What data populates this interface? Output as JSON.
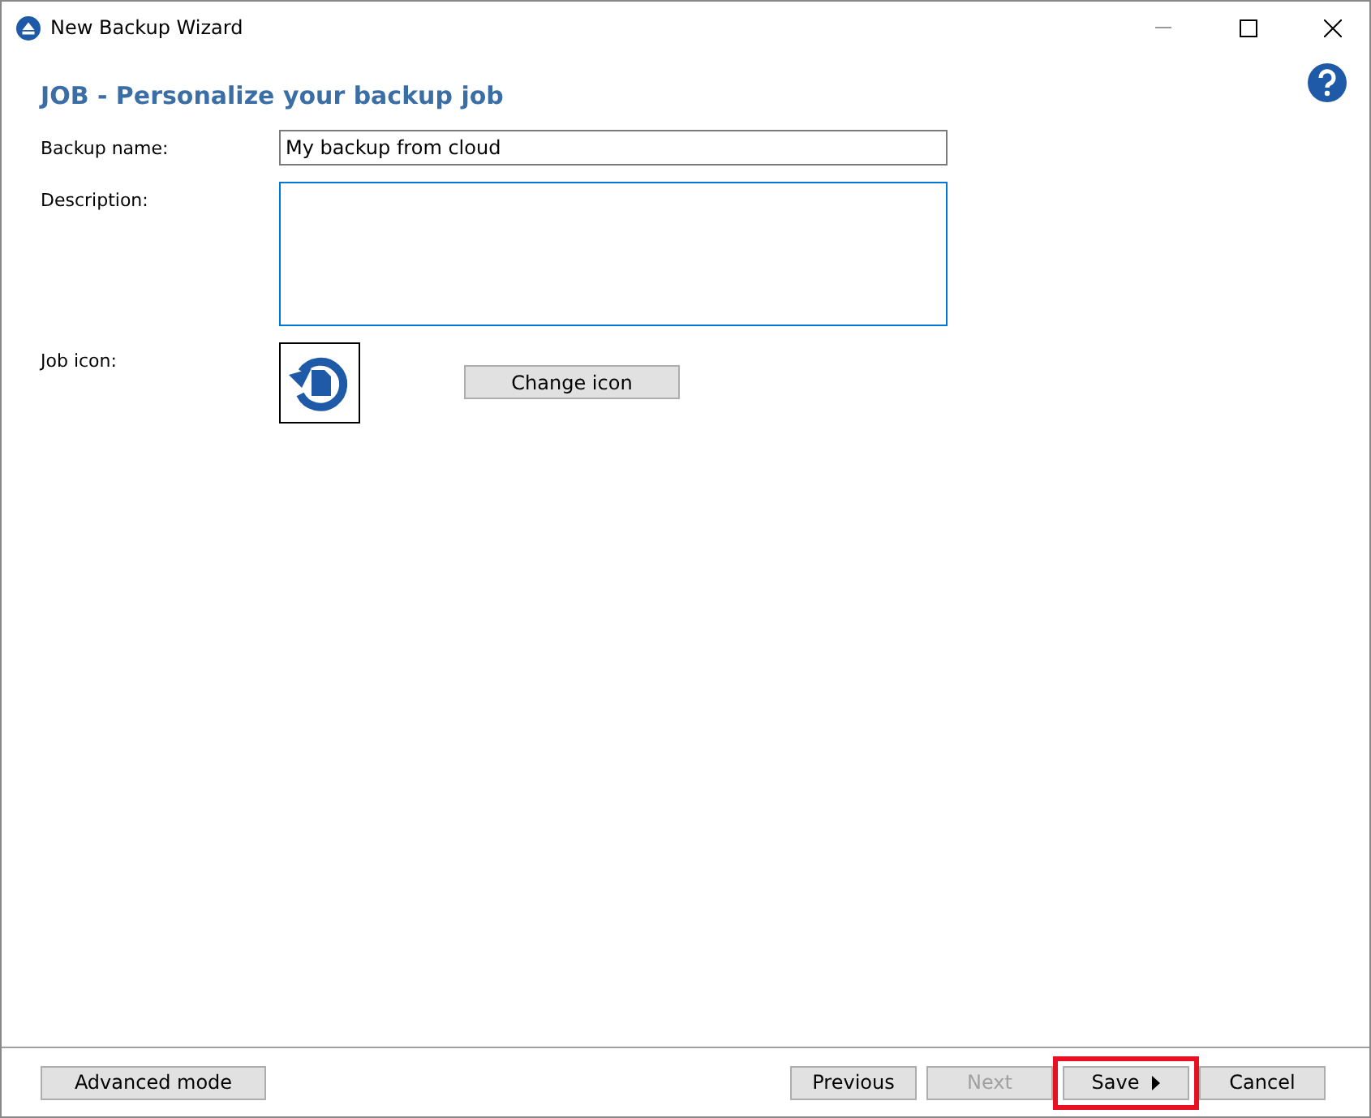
{
  "window": {
    "title": "New Backup Wizard"
  },
  "heading": "JOB - Personalize your backup job",
  "form": {
    "name_label": "Backup name:",
    "name_value": "My backup from cloud",
    "description_label": "Description:",
    "icon_label": "Job icon:",
    "change_icon": "Change icon"
  },
  "footer": {
    "advanced": "Advanced mode",
    "buttons": [
      {
        "label": "Previous",
        "disabled": false,
        "highlighted": false,
        "arrow": false
      },
      {
        "label": "Next",
        "disabled": true,
        "highlighted": false,
        "arrow": false
      },
      {
        "label": "Save",
        "disabled": false,
        "highlighted": true,
        "arrow": true
      },
      {
        "label": "Cancel",
        "disabled": false,
        "highlighted": false,
        "arrow": false
      }
    ]
  }
}
